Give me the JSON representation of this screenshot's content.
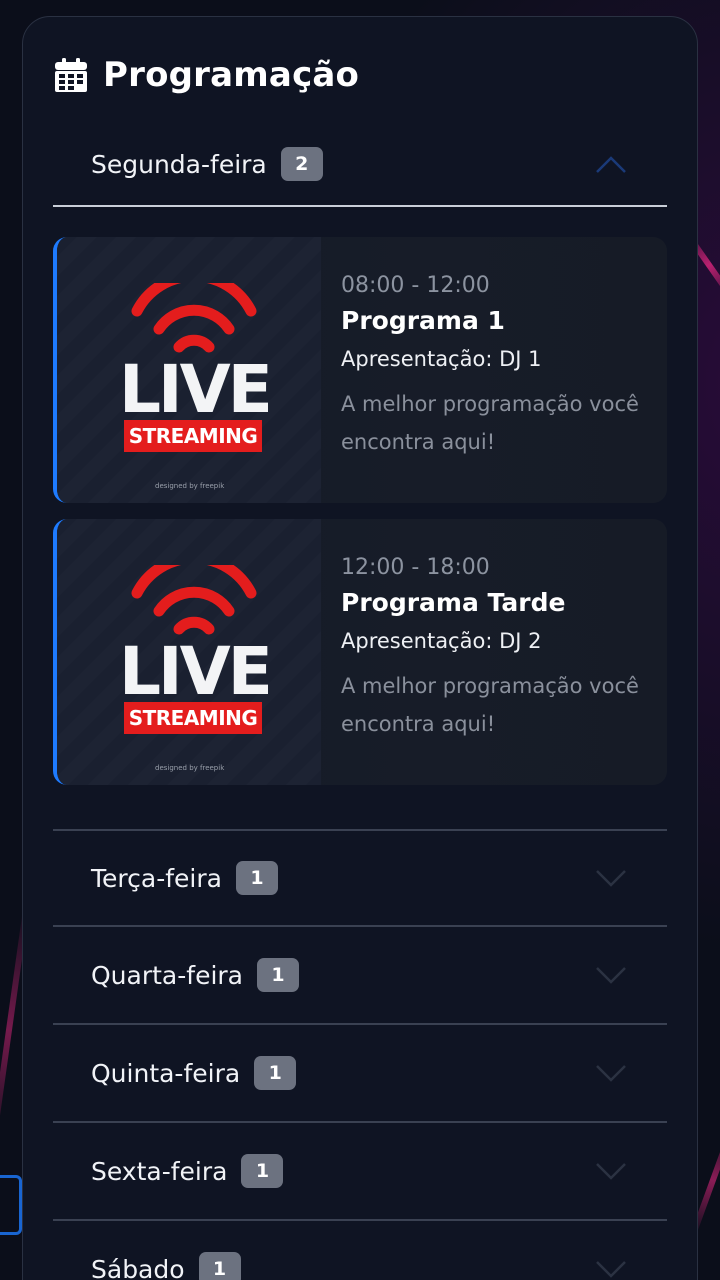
{
  "header": {
    "title": "Programação",
    "icon": "calendar-icon"
  },
  "colors": {
    "accent": "#1e7bff",
    "badge": "#6c7280",
    "panel": "#0f1423",
    "live_red": "#e41d1d"
  },
  "days": [
    {
      "label": "Segunda-feira",
      "count": "2",
      "expanded": true,
      "programs": [
        {
          "time": "08:00 - 12:00",
          "name": "Programa 1",
          "host": "Apresentação: DJ 1",
          "description": "A melhor programação você encontra aqui!",
          "image_text": "LIVE",
          "image_banner": "STREAMING",
          "image_credit": "designed by freepik"
        },
        {
          "time": "12:00 - 18:00",
          "name": "Programa Tarde",
          "host": "Apresentação: DJ 2",
          "description": "A melhor programação você encontra aqui!",
          "image_text": "LIVE",
          "image_banner": "STREAMING",
          "image_credit": "designed by freepik"
        }
      ]
    },
    {
      "label": "Terça-feira",
      "count": "1",
      "expanded": false
    },
    {
      "label": "Quarta-feira",
      "count": "1",
      "expanded": false
    },
    {
      "label": "Quinta-feira",
      "count": "1",
      "expanded": false
    },
    {
      "label": "Sexta-feira",
      "count": "1",
      "expanded": false
    },
    {
      "label": "Sábado",
      "count": "1",
      "expanded": false
    }
  ]
}
